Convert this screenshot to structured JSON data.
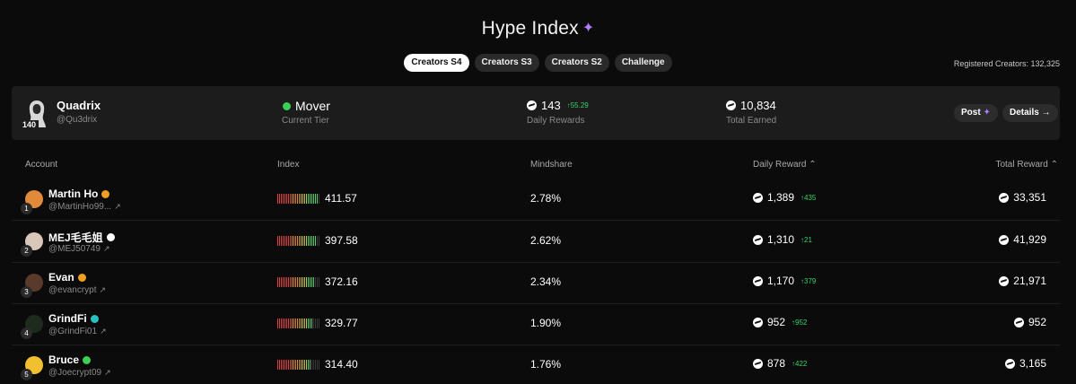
{
  "header": {
    "title": "Hype Index",
    "sparkle_icon": "sparkle-icon",
    "accent_color": "#b37cff"
  },
  "tabs": [
    {
      "label": "Creators S4",
      "active": true
    },
    {
      "label": "Creators S3",
      "active": false
    },
    {
      "label": "Creators S2",
      "active": false
    },
    {
      "label": "Challenge",
      "active": false
    }
  ],
  "registered_creators": "Registered Creators: 132,325",
  "me": {
    "name": "Quadrix",
    "handle": "@Qu3drix",
    "badge": "140",
    "tier": "Mover",
    "tier_label": "Current Tier",
    "daily_rewards": "143",
    "daily_change": "↑55.29",
    "daily_label": "Daily Rewards",
    "total_earned": "10,834",
    "total_label": "Total Earned",
    "post_label": "Post",
    "details_label": "Details →"
  },
  "table": {
    "headers": {
      "account": "Account",
      "index": "Index",
      "mindshare": "Mindshare",
      "daily_reward": "Daily Reward ⌃",
      "total_reward": "Total Reward ⌃"
    },
    "rows": [
      {
        "rank": "1",
        "name": "Martin Ho",
        "handle": "@MartinHo99...",
        "verified_color": "#f0a020",
        "avatar_color": "#e08a3a",
        "index": "411.57",
        "index_level": 0.95,
        "mindshare": "2.78%",
        "daily": "1,389",
        "daily_change": "↑435",
        "total": "33,351"
      },
      {
        "rank": "2",
        "name": "MEJ毛毛姐",
        "handle": "@MEJ50749",
        "verified_color": "#ffffff",
        "avatar_color": "#d9c7b8",
        "index": "397.58",
        "index_level": 0.92,
        "mindshare": "2.62%",
        "daily": "1,310",
        "daily_change": "↑21",
        "total": "41,929"
      },
      {
        "rank": "3",
        "name": "Evan",
        "handle": "@evancrypt",
        "verified_color": "#f0a020",
        "avatar_color": "#5a3a2a",
        "index": "372.16",
        "index_level": 0.88,
        "mindshare": "2.34%",
        "daily": "1,170",
        "daily_change": "↑379",
        "total": "21,971"
      },
      {
        "rank": "4",
        "name": "GrindFi",
        "handle": "@GrindFi01",
        "verified_color": "#2ac0c0",
        "avatar_color": "#1f2a1f",
        "index": "329.77",
        "index_level": 0.82,
        "mindshare": "1.90%",
        "daily": "952",
        "daily_change": "↑952",
        "total": "952"
      },
      {
        "rank": "5",
        "name": "Bruce",
        "handle": "@Joecrypt09",
        "verified_color": "#3ccf55",
        "avatar_color": "#f0c030",
        "index": "314.40",
        "index_level": 0.78,
        "mindshare": "1.76%",
        "daily": "878",
        "daily_change": "↑422",
        "total": "3,165"
      }
    ]
  }
}
